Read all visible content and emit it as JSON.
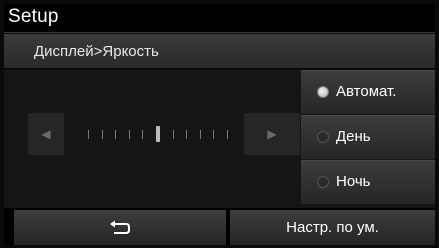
{
  "header": {
    "title": "Setup"
  },
  "breadcrumb": "Дисплей>Яркость",
  "slider": {
    "left_icon": "left-arrow-icon",
    "right_icon": "right-arrow-icon",
    "tick_count": 11,
    "active_index": 5
  },
  "options": [
    {
      "label": "Автомат.",
      "selected": true
    },
    {
      "label": "День",
      "selected": false
    },
    {
      "label": "Ночь",
      "selected": false
    }
  ],
  "bottom": {
    "back_icon": "back-arrow-icon",
    "default_label": "Настр. по ум."
  }
}
